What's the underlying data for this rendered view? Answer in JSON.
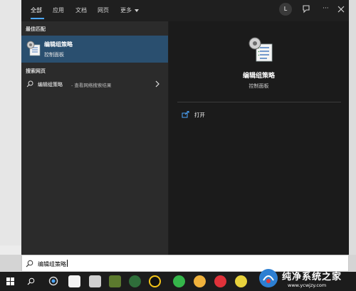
{
  "search_panel": {
    "tabs": [
      {
        "label": "全部"
      },
      {
        "label": "应用"
      },
      {
        "label": "文档"
      },
      {
        "label": "网页"
      },
      {
        "label": "更多"
      }
    ],
    "user_initial": "L",
    "more_options": "···"
  },
  "left": {
    "best_match_label": "最佳匹配",
    "best_match": {
      "title": "编辑组策略",
      "subtitle": "控制面板",
      "icon": "group-policy-icon"
    },
    "web_label": "搜索网页",
    "web_result": {
      "query": "编辑组策略",
      "hint": "- 查看网络搜索结果"
    }
  },
  "right": {
    "title": "编辑组策略",
    "subtitle": "控制面板",
    "actions": [
      {
        "label": "打开",
        "icon": "open-icon"
      }
    ]
  },
  "search_box": {
    "value": "编辑组策略"
  },
  "watermark": {
    "title": "纯净系统之家",
    "url": "www.ycwjzy.com"
  },
  "colors": {
    "accent": "#4ca7ff",
    "selected_row": "#2a4f6f",
    "panel_left": "#2b2b2b",
    "panel_right": "#1b1b1b"
  }
}
